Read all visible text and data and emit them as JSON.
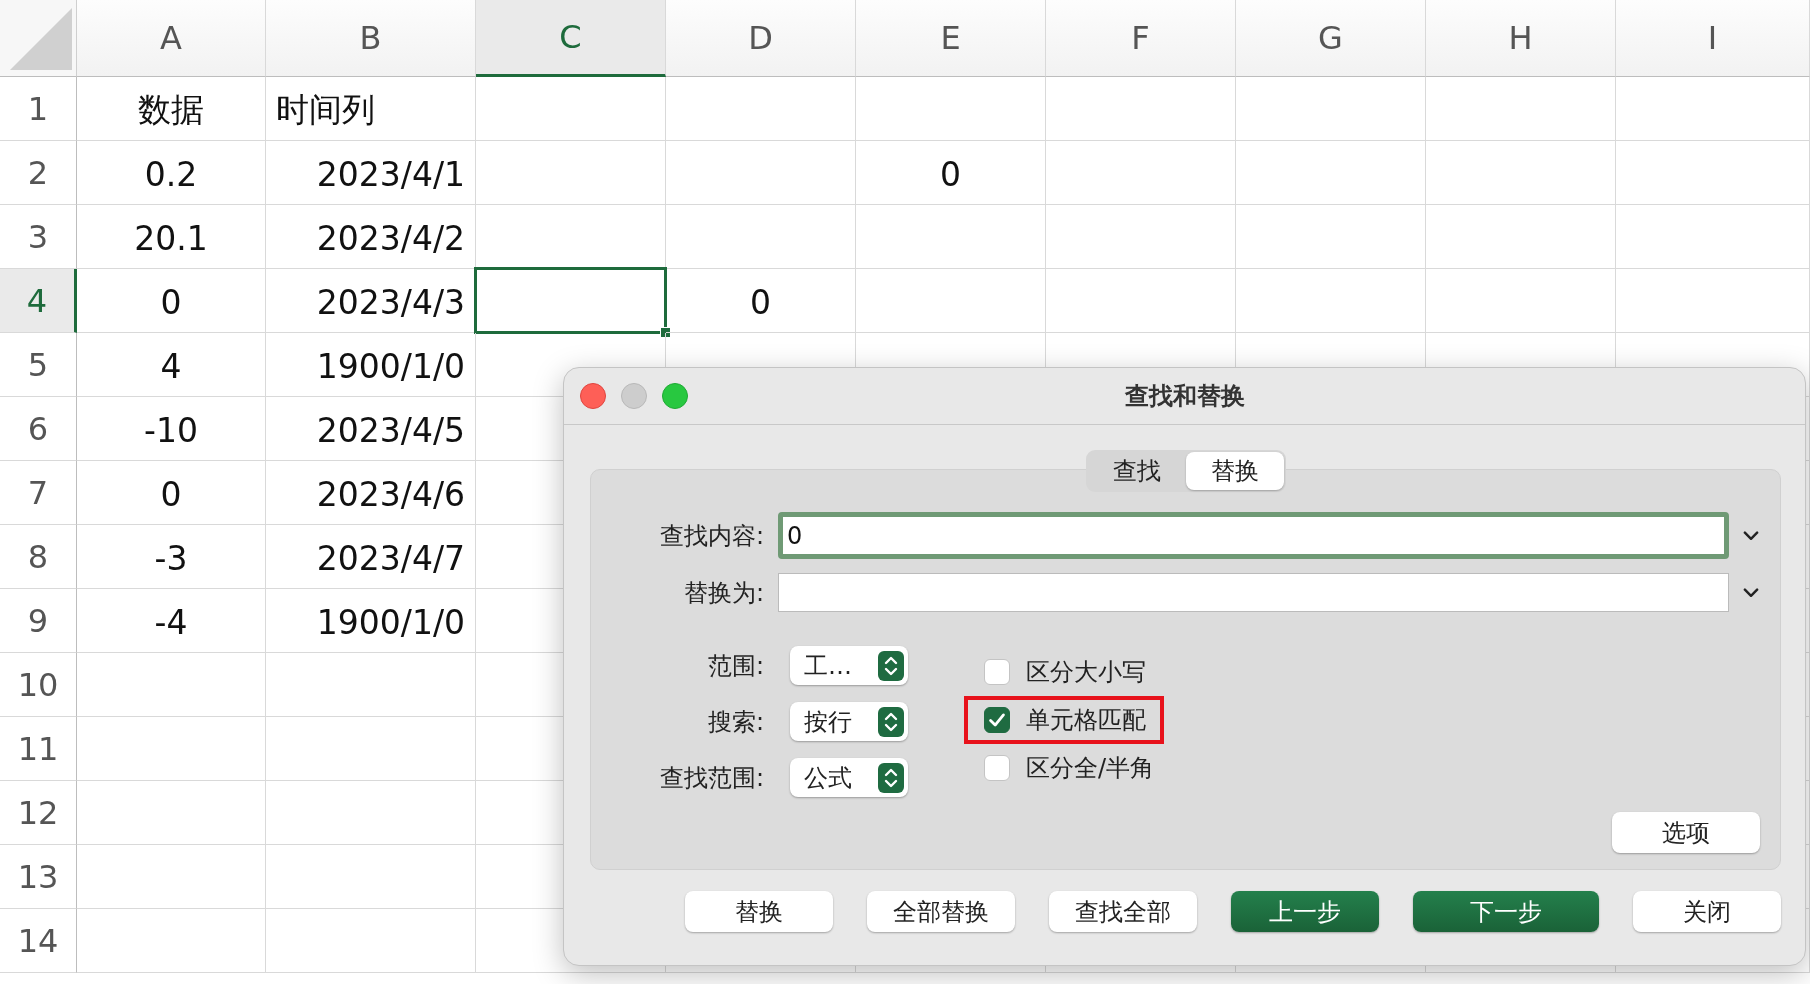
{
  "sheet": {
    "columns": [
      {
        "label": "A",
        "selected": false
      },
      {
        "label": "B",
        "selected": false
      },
      {
        "label": "C",
        "selected": true
      },
      {
        "label": "D",
        "selected": false
      },
      {
        "label": "E",
        "selected": false
      },
      {
        "label": "F",
        "selected": false
      },
      {
        "label": "G",
        "selected": false
      },
      {
        "label": "H",
        "selected": false
      },
      {
        "label": "I",
        "selected": false
      }
    ],
    "rows": [
      {
        "label": "1",
        "kind": "header",
        "selected": false,
        "cells": [
          "数据",
          "时间列"
        ]
      },
      {
        "label": "2",
        "kind": "data",
        "selected": false,
        "cells": [
          "0.2",
          "2023/4/1",
          null,
          null,
          "0"
        ]
      },
      {
        "label": "3",
        "kind": "data",
        "selected": false,
        "cells": [
          "20.1",
          "2023/4/2"
        ]
      },
      {
        "label": "4",
        "kind": "data",
        "selected": true,
        "cells": [
          "0",
          "2023/4/3",
          null,
          "0"
        ]
      },
      {
        "label": "5",
        "kind": "data",
        "selected": false,
        "cells": [
          "4",
          "1900/1/0"
        ]
      },
      {
        "label": "6",
        "kind": "data",
        "selected": false,
        "cells": [
          "-10",
          "2023/4/5"
        ]
      },
      {
        "label": "7",
        "kind": "data",
        "selected": false,
        "cells": [
          "0",
          "2023/4/6"
        ]
      },
      {
        "label": "8",
        "kind": "data",
        "selected": false,
        "cells": [
          "-3",
          "2023/4/7"
        ]
      },
      {
        "label": "9",
        "kind": "data",
        "selected": false,
        "cells": [
          "-4",
          "1900/1/0"
        ]
      },
      {
        "label": "10",
        "kind": "data",
        "selected": false,
        "cells": []
      },
      {
        "label": "11",
        "kind": "data",
        "selected": false,
        "cells": []
      },
      {
        "label": "12",
        "kind": "data",
        "selected": false,
        "cells": []
      },
      {
        "label": "13",
        "kind": "data",
        "selected": false,
        "cells": []
      },
      {
        "label": "14",
        "kind": "data",
        "selected": false,
        "cells": []
      }
    ]
  },
  "dialog": {
    "title": "查找和替换",
    "tabs": [
      {
        "label": "查找",
        "selected": false
      },
      {
        "label": "替换",
        "selected": true
      }
    ],
    "fields": [
      {
        "label": "查找内容:",
        "value": "0",
        "focused": true
      },
      {
        "label": "替换为:",
        "focused": false
      }
    ],
    "dropdowns": [
      {
        "label": "范围:",
        "value": "工…"
      },
      {
        "label": "搜索:",
        "value": "按行"
      },
      {
        "label": "查找范围:",
        "value": "公式"
      }
    ],
    "checkboxes": [
      {
        "label": "区分大小写",
        "checked": false,
        "highlighted": false
      },
      {
        "label": "单元格匹配",
        "checked": true,
        "highlighted": true
      },
      {
        "label": "区分全/半角",
        "checked": false,
        "highlighted": false
      }
    ],
    "options_button": "选项",
    "buttons": [
      {
        "label": "替换",
        "primary": false
      },
      {
        "label": "全部替换",
        "primary": false
      },
      {
        "label": "查找全部",
        "primary": false
      },
      {
        "label": "上一步",
        "primary": true
      },
      {
        "label": "下一步",
        "primary": true
      },
      {
        "label": "关闭",
        "primary": false
      }
    ]
  }
}
